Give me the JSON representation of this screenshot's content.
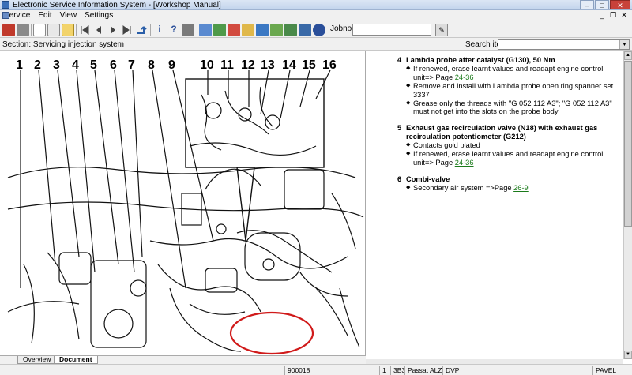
{
  "window": {
    "title": "Electronic Service Information System - [Workshop Manual]"
  },
  "menubar": {
    "items": [
      "Service",
      "Edit",
      "View",
      "Settings"
    ]
  },
  "toolbar": {
    "jobnote_label": "Jobnote:",
    "jobnote_value": ""
  },
  "section": {
    "label": "Section: Servicing injection system",
    "search_label": "Search item:",
    "search_value": ""
  },
  "diagram": {
    "callouts_top": [
      "1",
      "2",
      "3",
      "4",
      "5",
      "6",
      "7",
      "8",
      "9"
    ],
    "callouts_inset": [
      "10",
      "11",
      "12",
      "13",
      "14",
      "15",
      "16"
    ]
  },
  "document": {
    "items": [
      {
        "num": "4",
        "title": "Lambda probe after catalyst (G130), 50 Nm",
        "bullets": [
          {
            "text": "If renewed, erase learnt values and readapt engine control unit=> Page ",
            "link": "24-36"
          },
          {
            "text": "Remove and install with Lambda probe open ring spanner set 3337",
            "link": ""
          },
          {
            "text": "Grease only the threads with \"G 052 112 A3\"; \"G 052 112 A3\" must not get into the slots on the probe body",
            "link": ""
          }
        ]
      },
      {
        "num": "5",
        "title": "Exhaust gas recirculation valve (N18) with exhaust gas recirculation potentiometer (G212)",
        "bullets": [
          {
            "text": "Contacts gold plated",
            "link": ""
          },
          {
            "text": "If renewed, erase learnt values and readapt engine control unit=> Page ",
            "link": "24-36"
          }
        ]
      },
      {
        "num": "6",
        "title": "Combi-valve",
        "bullets": [
          {
            "text": "Secondary air system =>Page ",
            "link": "26-9"
          }
        ]
      }
    ]
  },
  "tabs": [
    "Overview",
    "Document"
  ],
  "status": {
    "code": "900018",
    "cell1": "1",
    "cell2": "3B3",
    "model": "Passat",
    "engine": "ALZ",
    "gearbox": "DVP",
    "user": "PAVEL"
  }
}
